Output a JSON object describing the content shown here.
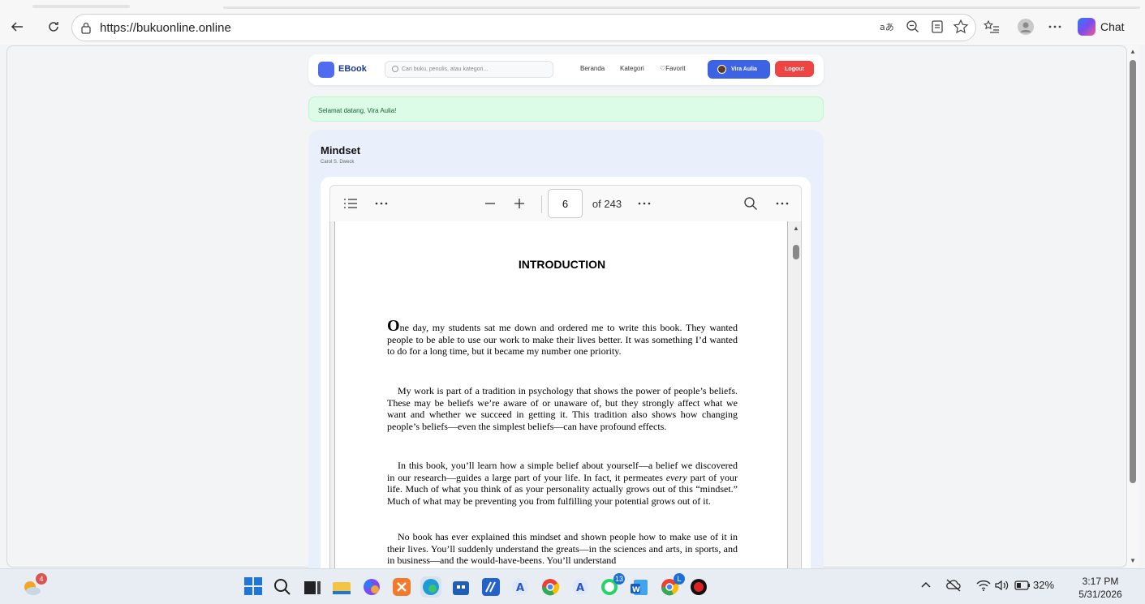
{
  "browser": {
    "url": "https://bukuonline.online",
    "chat_label": "Chat"
  },
  "navbar": {
    "brand": "EBook",
    "search_placeholder": "Cari buku, penulis, atau kategori...",
    "links": [
      "Beranda",
      "Kategori",
      "Favorit"
    ],
    "user_name": "Vira Aulia",
    "logout_label": "Logout"
  },
  "alert": {
    "message": "Selamat datang, Vira Aulia!"
  },
  "book": {
    "title": "Mindset",
    "author": "Carol S. Dweck"
  },
  "pdf": {
    "current_page": "6",
    "total_pages": "of 243",
    "heading": "INTRODUCTION",
    "paragraphs": {
      "p1_dropcap": "O",
      "p1_rest": "ne day, my students sat me down and ordered me to write this book. They wanted people to be able to use our work to make their lives better. It was something I’d wanted to do for a long time, but it became my number one priority.",
      "p2": "My work is part of a tradition in psychology that shows the power of people’s beliefs. These may be beliefs we’re aware of or unaware of, but they strongly affect what we want and whether we succeed in getting it. This tradition also shows how changing people’s beliefs—even the simplest beliefs—can have profound effects.",
      "p3_a": "In this book, you’ll learn how a simple belief about yourself—a belief we discovered in our research—guides a large part of your life. In fact, it permeates",
      "p3_em": "every",
      "p3_b": "part of your life. Much of what you think of as your personality actually grows out of this “mindset.” Much of what may be preventing you from fulfilling your potential grows out of it.",
      "p4": "No book has ever explained this mindset and shown people how to make use of it in their lives. You’ll suddenly understand the greats—in the sciences and arts, in sports, and in business—and the would-have-beens. You’ll understand"
    }
  },
  "taskbar": {
    "weather_badge": "4",
    "whatsapp_badge": "13",
    "chrome_badge": "L",
    "battery": "32%",
    "time": "3:17 PM",
    "date": "5/31/2026"
  },
  "colors": {
    "accent": "#3b63e3",
    "danger": "#ef4444",
    "success_bg": "#dcfce7"
  }
}
